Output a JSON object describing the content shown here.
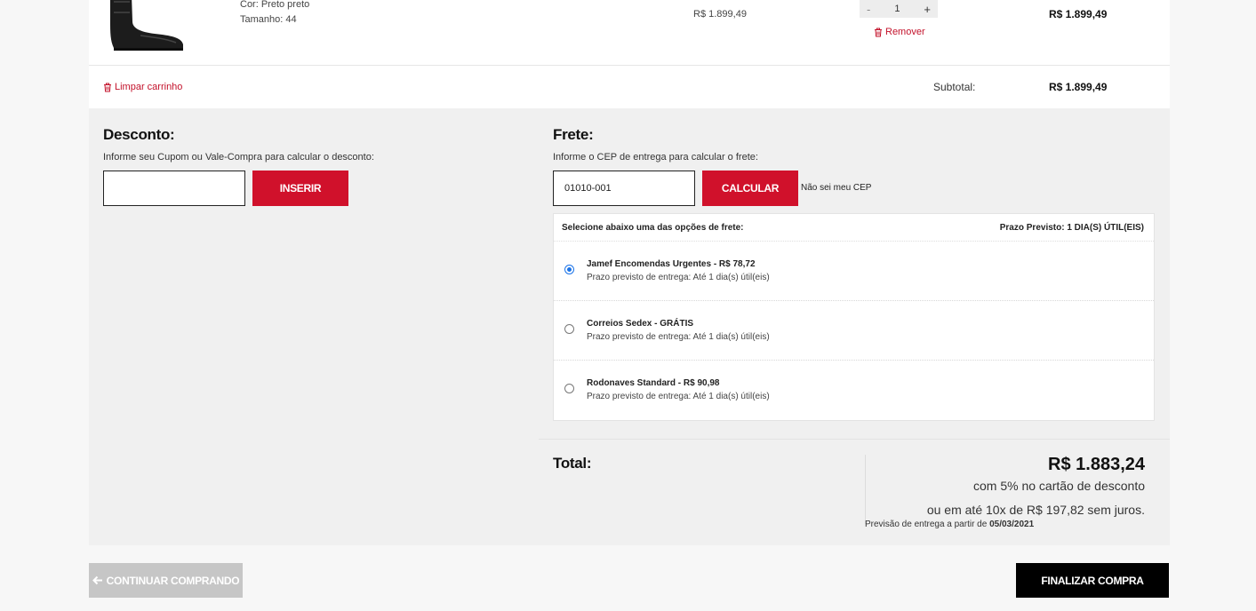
{
  "product": {
    "color_line": "Cor: Preto preto",
    "size_line": "Tamanho: 44",
    "unit_price": "R$ 1.899,49",
    "quantity": "1",
    "qty_minus": "-",
    "qty_plus": "+",
    "remove_label": "Remover",
    "line_total": "R$ 1.899,49"
  },
  "cart": {
    "clear_label": "Limpar carrinho",
    "subtotal_label": "Subtotal:",
    "subtotal_value": "R$ 1.899,49"
  },
  "discount": {
    "title": "Desconto:",
    "hint": "Informe seu Cupom ou Vale-Compra para calcular o desconto:",
    "input_value": "",
    "button": "INSERIR"
  },
  "shipping": {
    "title": "Frete:",
    "hint": "Informe o CEP de entrega para calcular o frete:",
    "cep_value": "01010-001",
    "button": "CALCULAR",
    "unknown_cep": "Não sei meu CEP",
    "options_header": "Selecione abaixo uma das opções de frete:",
    "estimate_header": "Prazo Previsto: 1 DIA(S) ÚTIL(EIS)",
    "options": [
      {
        "title": "Jamef Encomendas Urgentes - R$ 78,72",
        "sub": "Prazo previsto de entrega: Até 1 dia(s) útil(eis)",
        "selected": true
      },
      {
        "title": "Correios Sedex - GRÁTIS",
        "sub": "Prazo previsto de entrega: Até 1 dia(s) útil(eis)",
        "selected": false
      },
      {
        "title": "Rodonaves Standard - R$ 90,98",
        "sub": "Prazo previsto de entrega: Até 1 dia(s) útil(eis)",
        "selected": false
      }
    ]
  },
  "total": {
    "label": "Total:",
    "value": "R$ 1.883,24",
    "discount_note": "com 5% no cartão de desconto",
    "installments": "ou em até 10x de R$ 197,82 sem juros.",
    "delivery_prefix": "Previsão de entrega a partir de",
    "delivery_date": "05/03/2021"
  },
  "actions": {
    "continue": "CONTINUAR COMPRANDO",
    "checkout": "FINALIZAR COMPRA"
  },
  "colors": {
    "accent": "#d0112b",
    "checkout_bg": "#000000",
    "continue_bg": "#c6c6c6",
    "radio_selected": "#1a73e8"
  }
}
